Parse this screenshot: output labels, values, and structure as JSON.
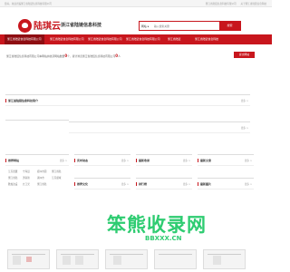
{
  "topbar": {
    "left_text": "您好，欢迎光临浙江省陆链信息科技有限公司",
    "links": [
      "浙江省陆链信息科技有限公司",
      "关于浙江省陆链信息科技"
    ]
  },
  "header": {
    "brand": "陆琪云",
    "brand_sub": "LUQIYUN.CN",
    "site_title": "浙江省陆链信息科技",
    "search": {
      "select_label": "网站",
      "placeholder": "输入搜索关键",
      "button_label": "搜索"
    }
  },
  "nav": {
    "items": [
      {
        "label": "浙江省陆链信息科技有限公司",
        "active": true
      },
      {
        "label": "浙江省陆链信息科技有限公司"
      },
      {
        "label": "浙江省陆链信息科技有限公司"
      },
      {
        "label": "浙江省陆链信息科技有限公司"
      },
      {
        "label": "浙江省陆链"
      },
      {
        "label": "浙江省陆链信息科技"
      }
    ]
  },
  "notice": {
    "text_before": "浙江省陆链信息科技有限公司本网站共收录网站数量",
    "count1": "0",
    "text_middle": "个，累计浏览浙江省陆链信息科技有限公司",
    "count2": "0",
    "text_after": "人",
    "submit_label": "提交网站"
  },
  "panels": {
    "intro": {
      "title": "浙江省陆链信息科技简介",
      "more": "更多 >"
    },
    "block": {
      "title": "推荐",
      "more": "更多 >"
    },
    "sites": {
      "title": "推荐网站",
      "more": "更多 >",
      "rows": [
        [
          "江苏宽翼",
          "宁海县",
          "郑州市园",
          "浙江省陆"
        ],
        [
          "浙江省陆",
          "济南新",
          "湖州市",
          "江苏盛域"
        ],
        [
          "雅加达设",
          "九江光",
          "浙江省陆",
          ""
        ]
      ]
    },
    "news": {
      "title": "实时动态",
      "more": "更多 >"
    },
    "hot": {
      "title": "最新收录",
      "more": "更多 >"
    },
    "recommend": {
      "title": "最新文章",
      "more": "更多 >"
    },
    "culture": {
      "title": "推荐文化",
      "more": "更多 >"
    },
    "ranking": {
      "title": "排行榜",
      "more": "更多 >"
    },
    "photos": {
      "title": "最新图片",
      "more": "更多 >"
    }
  },
  "watermark": {
    "text": "笨熊收录网",
    "url": "BBXXX.CN"
  },
  "colors": {
    "brand_red": "#c8161d",
    "watermark_green": "#2ecc71"
  }
}
